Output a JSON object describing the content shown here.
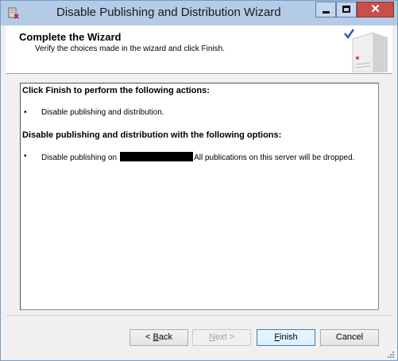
{
  "window": {
    "title": "Disable Publishing and Distribution Wizard",
    "minimize_glyph": "",
    "maximize_glyph": "",
    "close_glyph": "✕"
  },
  "header": {
    "title": "Complete the Wizard",
    "subtitle": "Verify the choices made in the wizard and click Finish."
  },
  "summary": {
    "section1_heading": "Click Finish to perform the following actions:",
    "section1_items": [
      "Disable publishing and distribution."
    ],
    "section2_heading": "Disable publishing and distribution with the following options:",
    "section2_item_prefix": "Disable publishing on",
    "section2_item_suffix": "All publications on this server will be dropped.",
    "bullet": "•"
  },
  "buttons": {
    "back_prefix": "< ",
    "back_accel": "B",
    "back_rest": "ack",
    "next_accel": "N",
    "next_rest": "ext >",
    "finish_accel": "F",
    "finish_rest": "inish",
    "cancel": "Cancel"
  },
  "colors": {
    "titlebar": "#b4cbe7",
    "close_button": "#c7504a",
    "default_button_border": "#3c7fb1",
    "redaction": "#000000"
  },
  "icons": {
    "app": "wizard-app-icon",
    "header_graphic": "server-checkmark-icon"
  }
}
